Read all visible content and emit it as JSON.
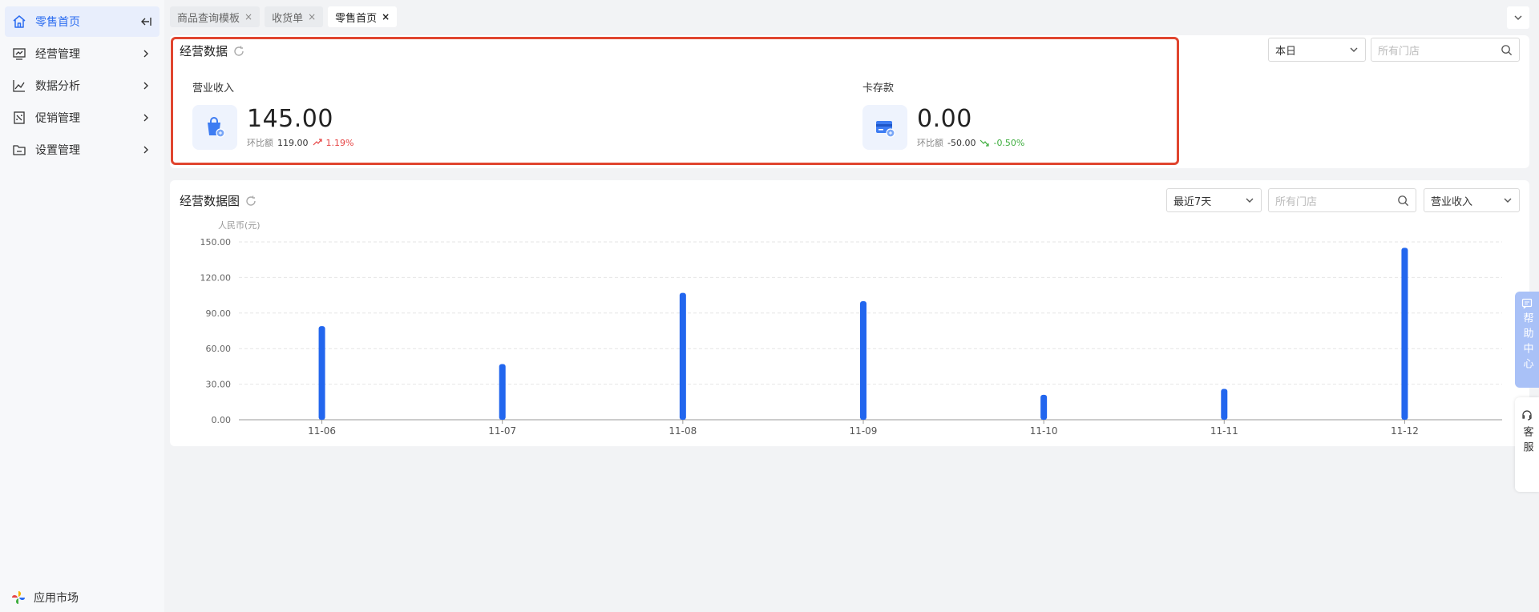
{
  "sidebar": {
    "items": [
      {
        "label": "零售首页",
        "icon": "home-icon",
        "active": true
      },
      {
        "label": "经营管理",
        "icon": "monitor-chart-icon"
      },
      {
        "label": "数据分析",
        "icon": "line-chart-icon"
      },
      {
        "label": "促销管理",
        "icon": "promo-tag-icon"
      },
      {
        "label": "设置管理",
        "icon": "folder-icon"
      }
    ],
    "app_market": "应用市场"
  },
  "tabs": [
    {
      "label": "商品查询模板",
      "close": "×"
    },
    {
      "label": "收货单",
      "close": "×"
    },
    {
      "label": "零售首页",
      "close": "×",
      "active": true
    }
  ],
  "business": {
    "title": "经营数据",
    "period": "本日",
    "store_placeholder": "所有门店",
    "revenue": {
      "label": "营业收入",
      "value": "145.00",
      "compare_label": "环比额",
      "compare_value": "119.00",
      "change": "1.19%"
    },
    "card_deposit": {
      "label": "卡存款",
      "value": "0.00",
      "compare_label": "环比额",
      "compare_value": "-50.00",
      "change": "-0.50%"
    }
  },
  "chart_panel": {
    "title": "经营数据图",
    "range": "最近7天",
    "store_placeholder": "所有门店",
    "metric": "营业收入"
  },
  "chart_data": {
    "type": "bar",
    "ylabel": "人民币(元)",
    "ylim": [
      0,
      150
    ],
    "yticks": [
      "0.00",
      "30.00",
      "60.00",
      "90.00",
      "120.00",
      "150.00"
    ],
    "categories": [
      "11-06",
      "11-07",
      "11-08",
      "11-09",
      "11-10",
      "11-11",
      "11-12"
    ],
    "values": [
      79,
      47,
      107,
      100,
      21,
      26,
      145
    ],
    "color": "#2266ee",
    "grid": true
  },
  "float": {
    "help_center": "帮助中心",
    "customer_service": "客服"
  },
  "colors": {
    "accent": "#2b6cf0",
    "highlight": "#e0452f",
    "up": "#e64545",
    "down": "#3fae3f"
  }
}
